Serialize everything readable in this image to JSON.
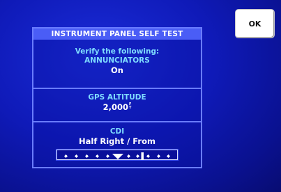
{
  "ok_button": {
    "label": "OK"
  },
  "panel": {
    "title": "INSTRUMENT PANEL SELF TEST",
    "verify_text": "Verify the following:",
    "sections": [
      {
        "label": "ANNUNCIATORS",
        "value": "On"
      },
      {
        "label": "GPS ALTITUDE",
        "value": "2,000",
        "unit_top": "F",
        "unit_bottom": "T"
      },
      {
        "label": "CDI",
        "value": "Half Right / From"
      }
    ]
  },
  "cdi_indicator": {
    "deflection": "half-right",
    "to_from": "from",
    "dots_each_side": 5,
    "colors": {
      "dot": "#ffffff",
      "needle": "#ffffff"
    }
  },
  "colors": {
    "background": "#0f1ab8",
    "panel_border": "#6a7cff",
    "title_bar": "#4a5df6",
    "label_text": "#7fdcff",
    "value_text": "#ffffff"
  }
}
